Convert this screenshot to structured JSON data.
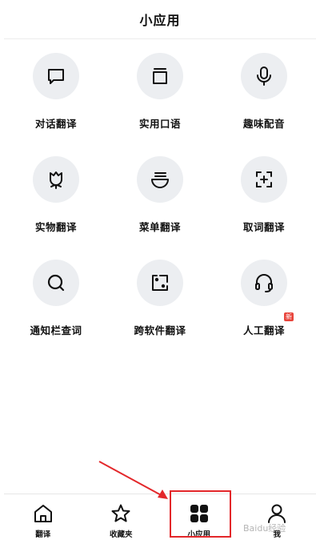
{
  "header": {
    "title": "小应用"
  },
  "apps": [
    {
      "label": "对话翻译",
      "icon": "chat-bubble-icon"
    },
    {
      "label": "实用口语",
      "icon": "book-icon"
    },
    {
      "label": "趣味配音",
      "icon": "microphone-icon"
    },
    {
      "label": "实物翻译",
      "icon": "tulip-icon"
    },
    {
      "label": "菜单翻译",
      "icon": "bowl-icon"
    },
    {
      "label": "取词翻译",
      "icon": "capture-plus-icon"
    },
    {
      "label": "通知栏查词",
      "icon": "search-icon"
    },
    {
      "label": "跨软件翻译",
      "icon": "cross-app-icon"
    },
    {
      "label": "人工翻译",
      "icon": "headset-icon",
      "badge": "新"
    }
  ],
  "tabbar": {
    "items": [
      {
        "label": "翻译",
        "icon": "home-icon"
      },
      {
        "label": "收藏夹",
        "icon": "star-icon"
      },
      {
        "label": "小应用",
        "icon": "grid-icon",
        "active": true
      },
      {
        "label": "我",
        "icon": "person-icon"
      }
    ]
  },
  "watermark": {
    "text": "Baidu经验"
  },
  "colors": {
    "icon_bg": "#eceef1",
    "badge": "#e8453c",
    "highlight": "#e3272a"
  }
}
